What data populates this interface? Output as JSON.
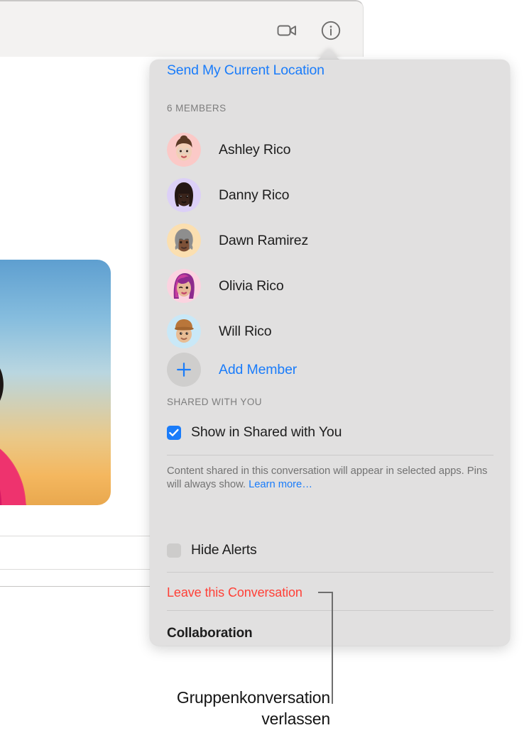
{
  "window": {
    "toolbar": {
      "facetime_icon": "video-camera-icon",
      "info_icon": "info-circle-icon"
    },
    "message_photo": {
      "alt": "photo of a person at sunset wearing a pink dress"
    }
  },
  "popover": {
    "send_location_label": "Send My Current Location",
    "members_header": "6 MEMBERS",
    "members": [
      {
        "name": "Ashley Rico",
        "avatar_bg": "#fbc9c7",
        "avatar": "memoji-ashley"
      },
      {
        "name": "Danny Rico",
        "avatar_bg": "#dcd0f7",
        "avatar": "memoji-danny"
      },
      {
        "name": "Dawn Ramirez",
        "avatar_bg": "#fbdfb0",
        "avatar": "memoji-dawn"
      },
      {
        "name": "Olivia Rico",
        "avatar_bg": "#fbd3e0",
        "avatar": "memoji-olivia"
      },
      {
        "name": "Will Rico",
        "avatar_bg": "#c9e8f7",
        "avatar": "memoji-will"
      }
    ],
    "add_member_label": "Add Member",
    "shared_with_you_header": "SHARED WITH YOU",
    "show_in_shared_label": "Show in Shared with You",
    "show_in_shared_checked": true,
    "shared_note_text": "Content shared in this conversation will appear in selected apps. Pins will always show. ",
    "shared_note_link": "Learn more…",
    "hide_alerts_label": "Hide Alerts",
    "hide_alerts_checked": false,
    "leave_conversation_label": "Leave this Conversation",
    "collaboration_label": "Collaboration"
  },
  "callout": {
    "caption_line1": "Gruppenkonversation",
    "caption_line2": "verlassen"
  },
  "colors": {
    "accent_blue": "#1a7cfa",
    "destructive_red": "#ff4037",
    "popover_bg": "#e1e0e0",
    "toolbar_bg": "#f3f2f1",
    "text_primary": "#1d1d1d",
    "text_secondary": "#7d7d7d"
  }
}
